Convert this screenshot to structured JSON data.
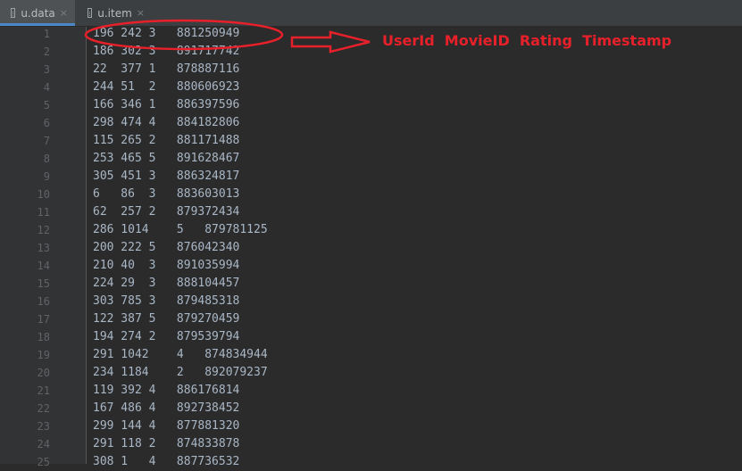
{
  "tabs": [
    {
      "label": "u.data",
      "close": "×",
      "active": true
    },
    {
      "label": "u.item",
      "close": "×",
      "active": false
    }
  ],
  "lines": [
    {
      "no": "1",
      "text": "196 242 3   881250949"
    },
    {
      "no": "2",
      "text": "186 302 3   891717742"
    },
    {
      "no": "3",
      "text": "22  377 1   878887116"
    },
    {
      "no": "4",
      "text": "244 51  2   880606923"
    },
    {
      "no": "5",
      "text": "166 346 1   886397596"
    },
    {
      "no": "6",
      "text": "298 474 4   884182806"
    },
    {
      "no": "7",
      "text": "115 265 2   881171488"
    },
    {
      "no": "8",
      "text": "253 465 5   891628467"
    },
    {
      "no": "9",
      "text": "305 451 3   886324817"
    },
    {
      "no": "10",
      "text": "6   86  3   883603013"
    },
    {
      "no": "11",
      "text": "62  257 2   879372434"
    },
    {
      "no": "12",
      "text": "286 1014    5   879781125"
    },
    {
      "no": "13",
      "text": "200 222 5   876042340"
    },
    {
      "no": "14",
      "text": "210 40  3   891035994"
    },
    {
      "no": "15",
      "text": "224 29  3   888104457"
    },
    {
      "no": "16",
      "text": "303 785 3   879485318"
    },
    {
      "no": "17",
      "text": "122 387 5   879270459"
    },
    {
      "no": "18",
      "text": "194 274 2   879539794"
    },
    {
      "no": "19",
      "text": "291 1042    4   874834944"
    },
    {
      "no": "20",
      "text": "234 1184    2   892079237"
    },
    {
      "no": "21",
      "text": "119 392 4   886176814"
    },
    {
      "no": "22",
      "text": "167 486 4   892738452"
    },
    {
      "no": "23",
      "text": "299 144 4   877881320"
    },
    {
      "no": "24",
      "text": "291 118 2   874833878"
    },
    {
      "no": "25",
      "text": "308 1   4   887736532"
    }
  ],
  "annotation": {
    "label": "UserId  MovieID  Rating  Timestamp",
    "color": "#e8202a"
  }
}
